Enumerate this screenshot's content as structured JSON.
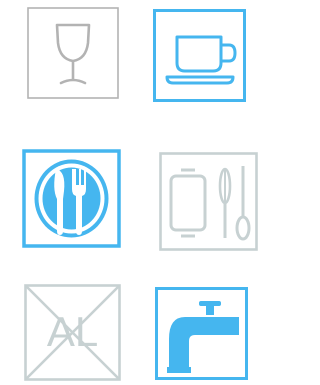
{
  "colors": {
    "gray": "#b3b3b3",
    "blue": "#45b6ef",
    "light_gray": "#c7d1d2",
    "white": "#ffffff"
  },
  "icons": [
    {
      "name": "food-safe-glass-icon",
      "style": "outlined-gray"
    },
    {
      "name": "cup-and-saucer-icon",
      "style": "outlined-blue"
    },
    {
      "name": "plate-fork-knife-icon",
      "style": "outlined-blue"
    },
    {
      "name": "baking-tray-utensils-icon",
      "style": "outlined-light-gray"
    },
    {
      "name": "no-aluminum-icon",
      "style": "outlined-light-gray"
    },
    {
      "name": "water-tap-icon",
      "style": "outlined-blue"
    }
  ],
  "no_aluminum_label": "AL"
}
